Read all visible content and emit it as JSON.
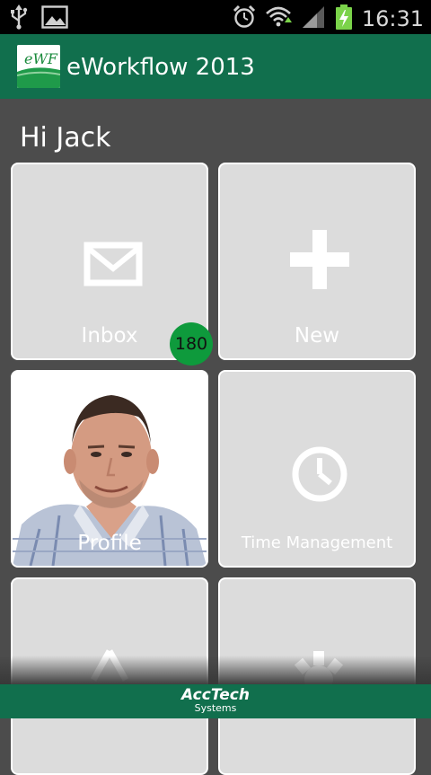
{
  "status_bar": {
    "time": "16:31",
    "icons": [
      "usb-icon",
      "image-notification-icon",
      "alarm-icon",
      "wifi-icon",
      "signal-icon",
      "battery-charging-icon"
    ]
  },
  "app": {
    "title": "eWorkflow 2013",
    "logo_text": "eWF"
  },
  "greeting": "Hi Jack",
  "tiles": [
    {
      "label": "Inbox",
      "icon": "mail-icon",
      "badge": "180"
    },
    {
      "label": "New",
      "icon": "plus-icon"
    },
    {
      "label": "Profile",
      "icon": "profile-photo"
    },
    {
      "label": "Time Management",
      "icon": "clock-icon"
    },
    {
      "label": "",
      "icon": "upload-icon"
    },
    {
      "label": "",
      "icon": "settings-icon"
    }
  ],
  "footer": {
    "brand_line1": "AccTech",
    "brand_line2": "Systems"
  },
  "colors": {
    "accent": "#116f4d",
    "background": "#4c4c4c",
    "tile": "#dcdcdc",
    "badge": "#0e9a3c"
  }
}
